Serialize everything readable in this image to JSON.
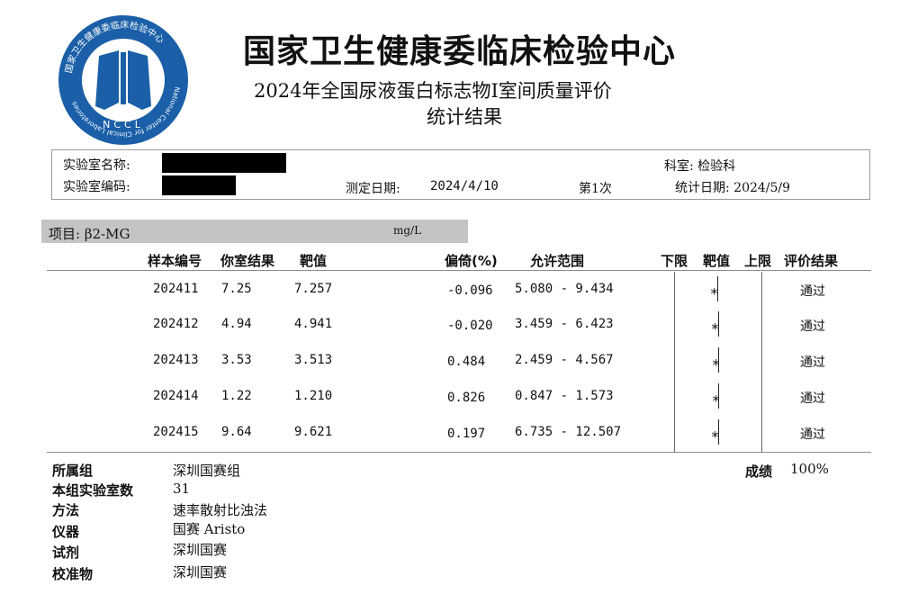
{
  "logo": {
    "ring_text": "国家卫生健康委临床检验中心",
    "ring_text_en": "National Center for Clinical Laboratories",
    "abbr": "NCCL",
    "color": "#1a5fa8"
  },
  "header": {
    "org": "国家卫生健康委临床检验中心",
    "title": "2024年全国尿液蛋白标志物Ⅰ室间质量评价",
    "subtitle": "统计结果"
  },
  "info": {
    "lab_name_label": "实验室名称:",
    "lab_code_label": "实验室编码:",
    "test_date_label": "测定日期:",
    "test_date": "2024/4/10",
    "round": "第1次",
    "dept": "科室: 检验科",
    "stat_date": "统计日期: 2024/5/9"
  },
  "project": {
    "label": "项目: β2-MG",
    "unit": "mg/L"
  },
  "table": {
    "headers": {
      "sample": "样本编号",
      "result": "你室结果",
      "target": "靶值",
      "bias": "偏倚(%)",
      "range": "允许范围",
      "lower": "下限",
      "target2": "靶值",
      "upper": "上限",
      "eval": "评价结果"
    },
    "rows": [
      {
        "sample": "202411",
        "result": "7.25",
        "target": "7.257",
        "bias": "-0.096",
        "range": "5.080 - 9.434",
        "eval": "通过",
        "position": 0.49
      },
      {
        "sample": "202412",
        "result": "4.94",
        "target": "4.941",
        "bias": "-0.020",
        "range": "3.459 - 6.423",
        "eval": "通过",
        "position": 0.5
      },
      {
        "sample": "202413",
        "result": "3.53",
        "target": "3.513",
        "bias": "0.484",
        "range": "2.459 - 4.567",
        "eval": "通过",
        "position": 0.51
      },
      {
        "sample": "202414",
        "result": "1.22",
        "target": "1.210",
        "bias": "0.826",
        "range": "0.847 - 1.573",
        "eval": "通过",
        "position": 0.51
      },
      {
        "sample": "202415",
        "result": "9.64",
        "target": "9.621",
        "bias": "0.197",
        "range": "6.735 - 12.507",
        "eval": "通过",
        "position": 0.5
      }
    ]
  },
  "footer": {
    "group_label": "所属组",
    "group": "深圳国赛组",
    "count_label": "本组实验室数",
    "count": "31",
    "method_label": "方法",
    "method": "速率散射比浊法",
    "instrument_label": "仪器",
    "instrument": "国赛 Aristo",
    "reagent_label": "试剂",
    "reagent": "深圳国赛",
    "calibrator_label": "校准物",
    "calibrator": "深圳国赛",
    "score_label": "成绩",
    "score": "100%"
  }
}
